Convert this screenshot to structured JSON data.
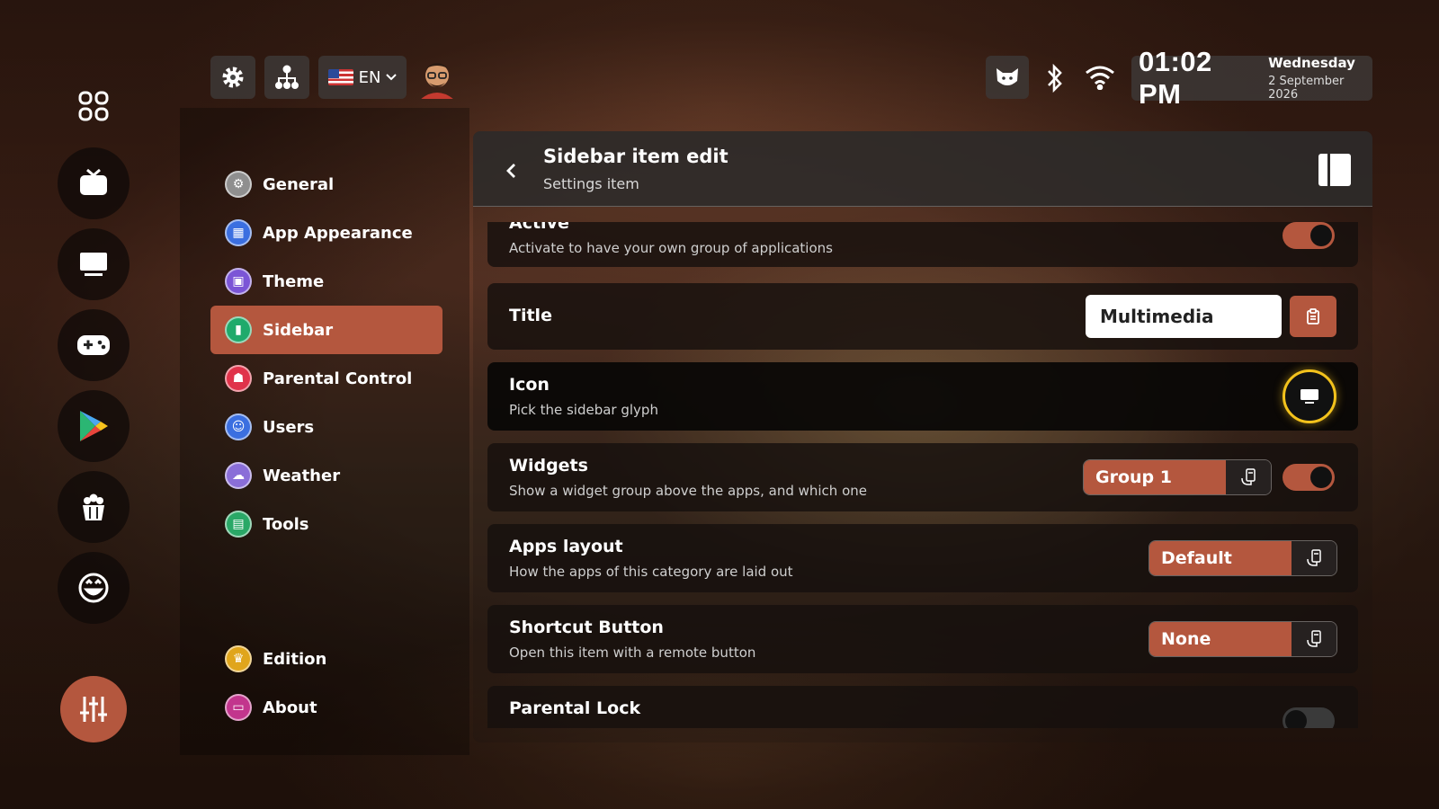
{
  "topbar": {
    "language": "EN",
    "status_icons": [
      "cat-icon",
      "bluetooth-icon",
      "wifi-icon"
    ],
    "time": "01:02 PM",
    "day": "Wednesday",
    "date": "2 September 2026"
  },
  "dock": {
    "items": [
      "apps-grid-icon",
      "tv-icon",
      "monitor-icon",
      "gamepad-icon",
      "play-store-icon",
      "popcorn-icon",
      "emoji-icon",
      "sliders-icon"
    ],
    "active": "sliders-icon"
  },
  "nav": {
    "items": [
      {
        "label": "General",
        "color": "#9a9a9a"
      },
      {
        "label": "App Appearance",
        "color": "#3b6fe0"
      },
      {
        "label": "Theme",
        "color": "#7b55d6"
      },
      {
        "label": "Sidebar",
        "color": "#1faa6b"
      },
      {
        "label": "Parental Control",
        "color": "#e0334a"
      },
      {
        "label": "Users",
        "color": "#3b6fe0"
      },
      {
        "label": "Weather",
        "color": "#8a6ed8"
      },
      {
        "label": "Tools",
        "color": "#2aa867"
      }
    ],
    "bottom": [
      {
        "label": "Edition",
        "color": "#e0a51c"
      },
      {
        "label": "About",
        "color": "#c2358d"
      }
    ],
    "selected": "Sidebar"
  },
  "panel": {
    "title": "Sidebar item edit",
    "subtitle": "Settings item",
    "rows": {
      "active": {
        "label": "Active",
        "desc": "Activate to have your own group of applications",
        "on": true
      },
      "title": {
        "label": "Title",
        "value": "Multimedia"
      },
      "icon": {
        "label": "Icon",
        "desc": "Pick the sidebar glyph"
      },
      "widgets": {
        "label": "Widgets",
        "desc": "Show a widget group above the apps, and which one",
        "value": "Group 1",
        "on": true
      },
      "apps_layout": {
        "label": "Apps layout",
        "desc": "How the apps of this category are laid out",
        "value": "Default"
      },
      "shortcut": {
        "label": "Shortcut Button",
        "desc": "Open this item with a remote button",
        "value": "None"
      },
      "parental_lock": {
        "label": "Parental Lock",
        "on": false
      }
    }
  },
  "colors": {
    "accent": "#b4573e",
    "focus_ring": "#f3c21c"
  }
}
